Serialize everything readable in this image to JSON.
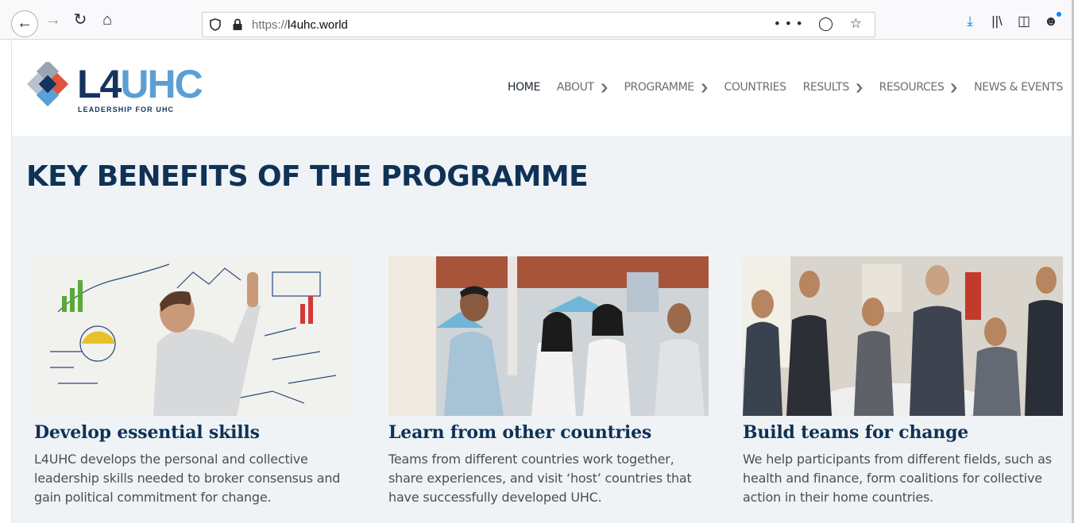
{
  "browser": {
    "url_scheme": "https://",
    "url_host": "l4uhc.world",
    "page_actions": "•••",
    "icons": [
      "back-icon",
      "forward-icon",
      "reload-icon",
      "home-icon",
      "shield-icon",
      "lock-icon",
      "pocket-icon",
      "bookmark-star-icon",
      "download-icon",
      "library-icon",
      "sidebar-icon",
      "account-icon"
    ]
  },
  "site": {
    "logo": {
      "l4": "L4",
      "uhc": "UHC",
      "tagline": "LEADERSHIP FOR UHC",
      "colors": [
        "#e0533d",
        "#14345f",
        "#5aa0d6",
        "#9aa5b1"
      ]
    },
    "nav": [
      {
        "label": "HOME",
        "active": true,
        "dropdown": false
      },
      {
        "label": "ABOUT",
        "dropdown": true
      },
      {
        "label": "PROGRAMME",
        "dropdown": true
      },
      {
        "label": "COUNTRIES",
        "dropdown": false
      },
      {
        "label": "RESULTS",
        "dropdown": true
      },
      {
        "label": "RESOURCES",
        "dropdown": true
      },
      {
        "label": "NEWS & EVENTS",
        "dropdown": false
      }
    ]
  },
  "main": {
    "title": "KEY BENEFITS OF THE PROGRAMME",
    "cards": [
      {
        "title": "Develop essential skills",
        "text": "L4UHC develops the personal and collective leadership skills needed to broker consensus and gain political commitment for change."
      },
      {
        "title": "Learn from other countries",
        "text": "Teams from different countries work together, share experiences, and visit ‘host’ countries that have successfully developed UHC."
      },
      {
        "title": "Build teams for change",
        "text": "We help participants from different fields, such as health and finance, form coalitions for collective action in their home countries."
      }
    ]
  },
  "colors": {
    "navy": "#0f3256",
    "section_bg": "#eff3f6",
    "nav_text": "#6a6e74"
  }
}
